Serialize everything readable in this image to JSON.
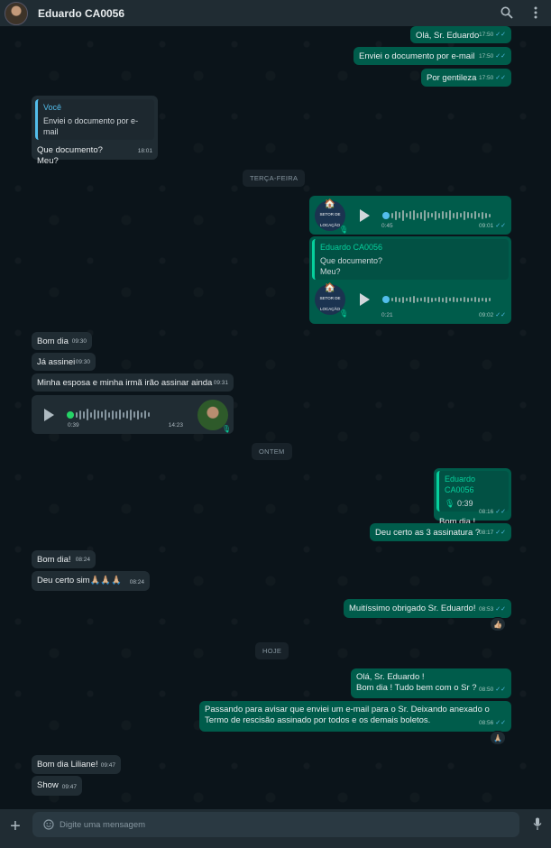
{
  "header": {
    "contact_name": "Eduardo CA0056"
  },
  "composer": {
    "placeholder": "Digite uma mensagem"
  },
  "separators": {
    "s1": "TERÇA-FEIRA",
    "s2": "ONTEM",
    "s3": "HOJE"
  },
  "messages": {
    "m1": {
      "text": "Olá, Sr. Eduardo",
      "time": "17:50"
    },
    "m2": {
      "text": "Enviei o documento por e-mail",
      "time": "17:50"
    },
    "m3": {
      "text": "Por gentileza",
      "time": "17:50"
    },
    "m4": {
      "quote_name": "Você",
      "quote_text": "Enviei o documento por e-mail",
      "line1": "Que documento?",
      "line2": "Meu?",
      "time": "18:01"
    },
    "m5": {
      "duration": "0:45",
      "time": "09:01"
    },
    "m6": {
      "quote_name": "Eduardo CA0056",
      "quote_line1": "Que documento?",
      "quote_line2": "Meu?",
      "duration": "0:21",
      "time": "09:02"
    },
    "m7": {
      "text": "Bom dia",
      "time": "09:30"
    },
    "m8": {
      "text": "Já assinei",
      "time": "09:30"
    },
    "m9": {
      "text": "Minha esposa e minha irmã irão assinar ainda",
      "time": "09:31"
    },
    "m10": {
      "duration": "0:39",
      "time": "14:23"
    },
    "m11": {
      "quote_name": "Eduardo CA0056",
      "quote_voice": "0:39",
      "text": "Bom dia !",
      "time": "08:16"
    },
    "m12": {
      "text": "Deu certo as 3 assinatura ?",
      "time": "08:17"
    },
    "m13": {
      "text": "Bom dia!",
      "time": "08:24"
    },
    "m14": {
      "text": "Deu certo sim🙏🏼🙏🏼🙏🏼",
      "time": "08:24"
    },
    "m15": {
      "text": "Muitíssimo obrigado Sr. Eduardo!",
      "time": "08:53",
      "reaction": "👍🏼"
    },
    "m16": {
      "line1": "Olá, Sr. Eduardo !",
      "line2": "Bom dia ! Tudo bem com o Sr ?",
      "time": "08:50"
    },
    "m17": {
      "line1": "Passando para avisar que enviei um e-mail para o Sr. Deixando anexado o",
      "line2": "Termo de rescisão assinado por todos e os demais boletos.",
      "time": "08:56",
      "reaction": "🙏🏼"
    },
    "m18": {
      "text": "Bom dia Liliane!",
      "time": "09:47"
    },
    "m19": {
      "text": "Show",
      "time": "09:47"
    }
  },
  "avatar_label": {
    "l1": "SETOR DE",
    "l2": "LOCAÇÃO"
  },
  "colors": {
    "outgoing": "#005c4b",
    "incoming": "#202c33",
    "background": "#0b141a",
    "read_ticks": "#53bdeb"
  }
}
